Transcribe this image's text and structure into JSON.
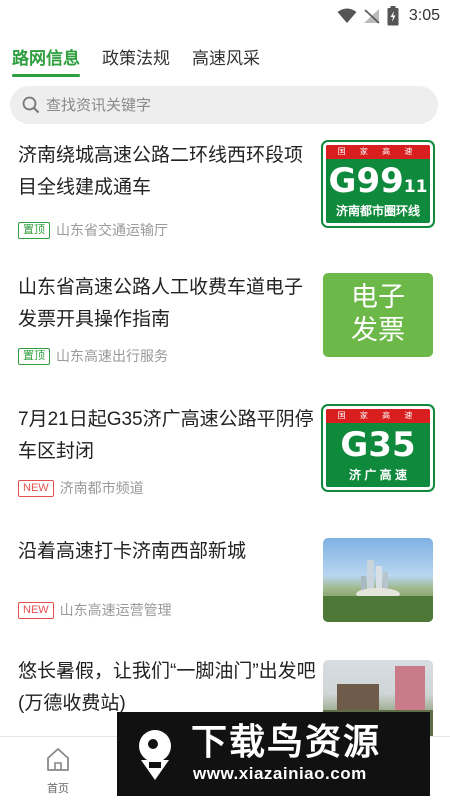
{
  "status_bar": {
    "time": "3:05",
    "icons": [
      "wifi-icon",
      "no-signal-icon",
      "battery-icon"
    ]
  },
  "tabs": [
    {
      "label": "路网信息",
      "active": true
    },
    {
      "label": "政策法规",
      "active": false
    },
    {
      "label": "高速风采",
      "active": false
    }
  ],
  "search": {
    "placeholder": "查找资讯关键字"
  },
  "news": [
    {
      "title": "济南绕城高速公路二环线西环段项目全线建成通车",
      "tag": "置顶",
      "tag_color": "green",
      "source": "山东省交通运输厅",
      "thumb": {
        "type": "sign",
        "top": "国 家 高 速",
        "code": "G99",
        "code_sub": "11",
        "bottom": "济南都市圈环线"
      }
    },
    {
      "title": "山东省高速公路人工收费车道电子发票开具操作指南",
      "tag": "置顶",
      "tag_color": "green",
      "source": "山东高速出行服务",
      "thumb": {
        "type": "text-card",
        "line1": "电子",
        "line2": "发票"
      }
    },
    {
      "title": "7月21日起G35济广高速公路平阴停车区封闭",
      "tag": "NEW",
      "tag_color": "red",
      "source": "济南都市频道",
      "thumb": {
        "type": "sign",
        "top": "国 家 高 速",
        "code": "G35",
        "code_sub": "",
        "bottom": "济 广 高 速"
      }
    },
    {
      "title": "沿着高速打卡济南西部新城",
      "tag": "NEW",
      "tag_color": "red",
      "source": "山东高速运营管理",
      "thumb": {
        "type": "photo"
      }
    },
    {
      "title": "悠长暑假，让我们“一脚油门”出发吧(万德收费站)",
      "tag": "",
      "tag_color": "",
      "source": "",
      "thumb": {
        "type": "photo"
      }
    }
  ],
  "bottom_nav": {
    "home_label": "首页"
  },
  "watermark": {
    "title": "下载鸟资源",
    "url": "www.xiazainiao.com"
  },
  "colors": {
    "accent": "#2e9e3e",
    "new_tag": "#e45050",
    "sign_green": "#0f8a3d",
    "sign_red": "#d81e1e"
  }
}
